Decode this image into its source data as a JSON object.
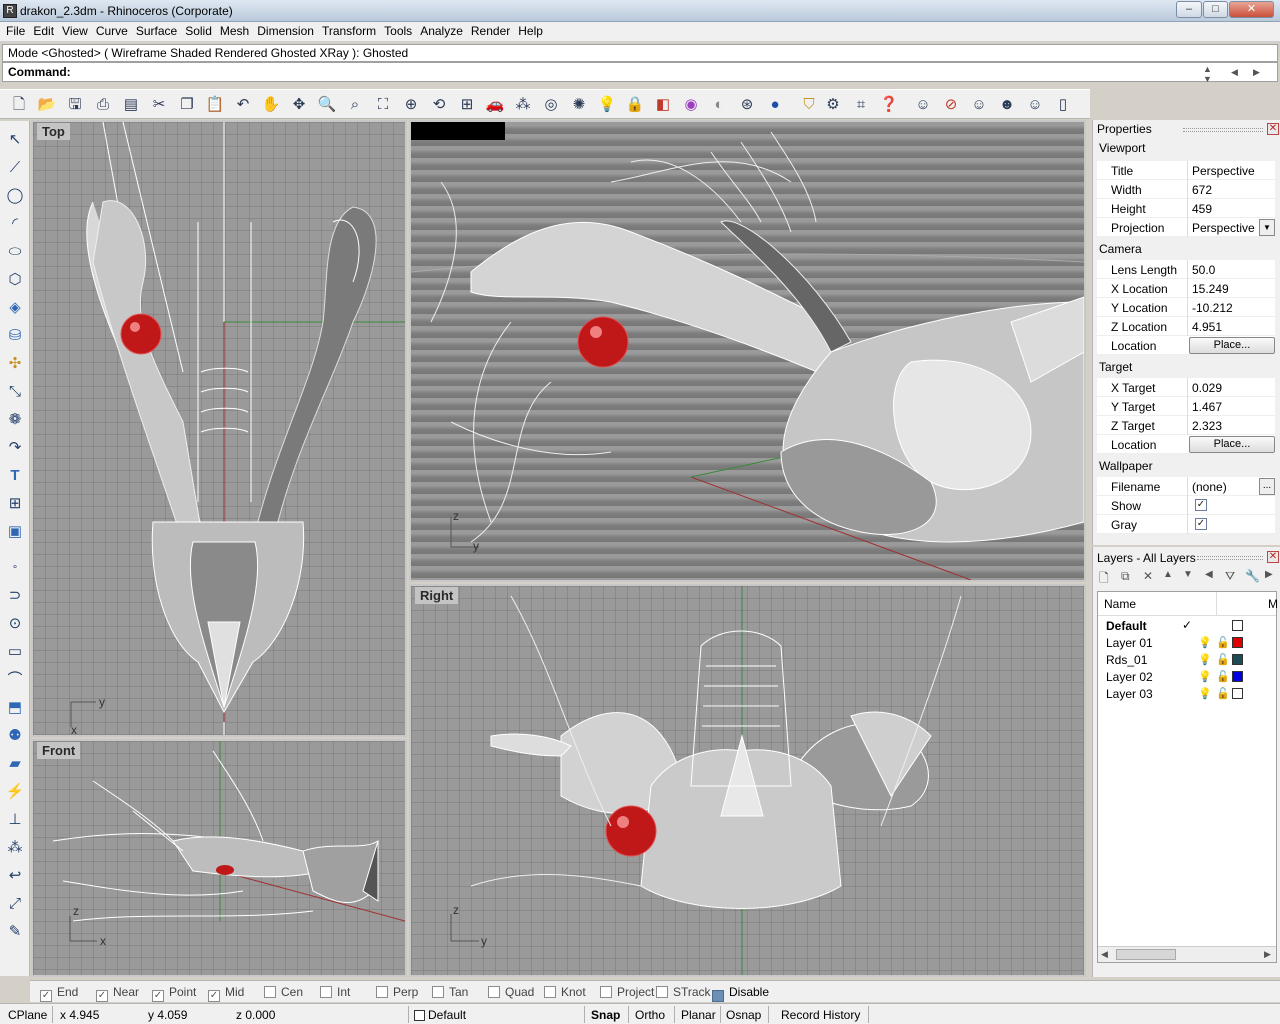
{
  "window": {
    "title": "drakon_2.3dm - Rhinoceros (Corporate)",
    "min": "–",
    "max": "□",
    "close": "✕"
  },
  "menu": [
    "File",
    "Edit",
    "View",
    "Curve",
    "Surface",
    "Solid",
    "Mesh",
    "Dimension",
    "Transform",
    "Tools",
    "Analyze",
    "Render",
    "Help"
  ],
  "command": {
    "history": "Mode <Ghosted> ( Wireframe  Shaded  Rendered  Ghosted  XRay ): Ghosted",
    "label": "Command:",
    "value": ""
  },
  "toolbar": [
    "new-file",
    "open",
    "save",
    "print",
    "page-setup",
    "cut",
    "copy",
    "paste",
    "undo",
    "pan",
    "move",
    "zoom-dynamic",
    "zoom-window",
    "zoom-extents",
    "zoom-selected",
    "rotate-view",
    "four-viewports",
    "car",
    "points",
    "snap",
    "lights",
    "light-bulb",
    "lock",
    "layers",
    "color-wheel",
    "sphere-shaded",
    "sphere-wire",
    "render-sphere",
    "paint-bucket",
    "settings",
    "grid-snap",
    "help",
    "face-1",
    "face-2",
    "face-3",
    "face-4",
    "face-5",
    "face-6"
  ],
  "lefttools": [
    "select-arrow",
    "polyline",
    "circle",
    "arc",
    "ellipse",
    "polygon",
    "box",
    "cylinder",
    "transform",
    "blend",
    "boolean",
    "curve",
    "text",
    "array",
    "solid-box",
    "point",
    "curve-points",
    "circle-center",
    "rectangle",
    "arc-2",
    "extrude",
    "sphere",
    "plane",
    "render",
    "dimension",
    "group",
    "curve-2",
    "move-2",
    "edit"
  ],
  "viewports": {
    "top": "Top",
    "perspective": "",
    "front": "Front",
    "right": "Right"
  },
  "axes": {
    "top": [
      "y",
      "x"
    ],
    "front": [
      "z",
      "x"
    ],
    "right": [
      "z",
      "y"
    ],
    "perspective": [
      "z",
      "y"
    ]
  },
  "properties": {
    "header": "Properties",
    "viewport_section": "Viewport",
    "viewport": [
      [
        "Title",
        "Perspective"
      ],
      [
        "Width",
        "672"
      ],
      [
        "Height",
        "459"
      ],
      [
        "Projection",
        "Perspective"
      ]
    ],
    "camera_section": "Camera",
    "camera": [
      [
        "Lens Length",
        "50.0"
      ],
      [
        "X Location",
        "15.249"
      ],
      [
        "Y Location",
        "-10.212"
      ],
      [
        "Z Location",
        "4.951"
      ],
      [
        "Location",
        "Place..."
      ]
    ],
    "target_section": "Target",
    "target": [
      [
        "X Target",
        "0.029"
      ],
      [
        "Y Target",
        "1.467"
      ],
      [
        "Z Target",
        "2.323"
      ],
      [
        "Location",
        "Place..."
      ]
    ],
    "wallpaper_section": "Wallpaper",
    "wallpaper": [
      [
        "Filename",
        "(none)"
      ],
      [
        "Show",
        "✓"
      ],
      [
        "Gray",
        "✓"
      ]
    ],
    "browse": "..."
  },
  "layers": {
    "header": "Layers - All Layers",
    "col_name": "Name",
    "col_current": "✓",
    "col_m": "M",
    "rows": [
      {
        "name": "Default",
        "current": "✓",
        "color": "#ffffff"
      },
      {
        "name": "Layer 01",
        "current": "",
        "color": "#e00000"
      },
      {
        "name": "Rds_01",
        "current": "",
        "color": "#1c4d55"
      },
      {
        "name": "Layer 02",
        "current": "",
        "color": "#0000e0"
      },
      {
        "name": "Layer 03",
        "current": "",
        "color": "#ffffff"
      }
    ]
  },
  "osnap": [
    [
      "End",
      "✓"
    ],
    [
      "Near",
      "✓"
    ],
    [
      "Point",
      "✓"
    ],
    [
      "Mid",
      "✓"
    ],
    [
      "Cen",
      ""
    ],
    [
      "Int",
      ""
    ],
    [
      "Perp",
      ""
    ],
    [
      "Tan",
      ""
    ],
    [
      "Quad",
      ""
    ],
    [
      "Knot",
      ""
    ],
    [
      "Project",
      ""
    ],
    [
      "STrack",
      ""
    ],
    [
      "Disable",
      "■"
    ]
  ],
  "status": {
    "cplane": "CPlane",
    "x": "x 4.945",
    "y": "y 4.059",
    "z": "z 0.000",
    "layer": "Default",
    "snap": "Snap",
    "ortho": "Ortho",
    "planar": "Planar",
    "osnap": "Osnap",
    "history": "Record History"
  }
}
